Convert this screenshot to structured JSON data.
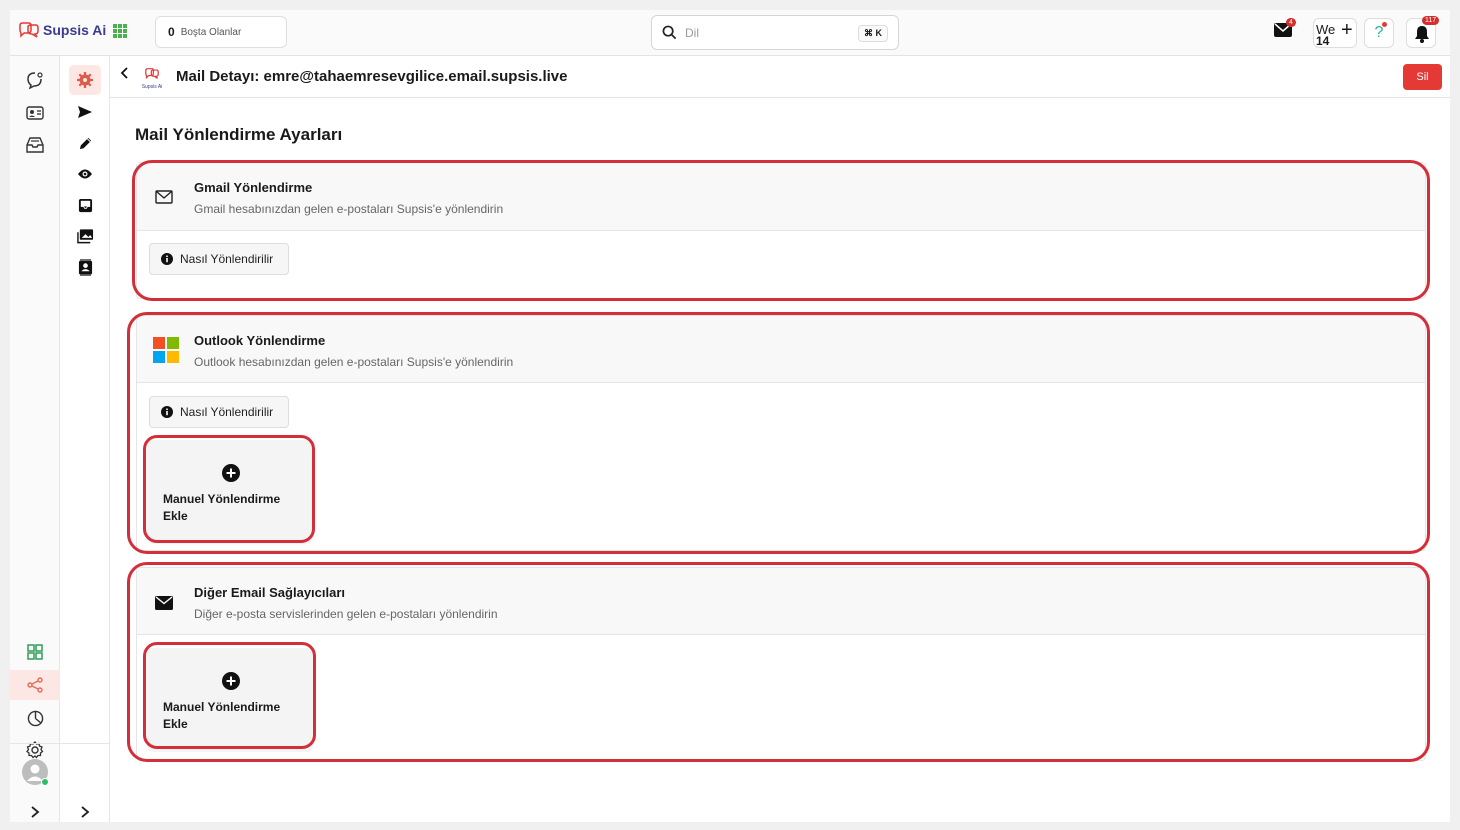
{
  "brand": {
    "name": "Supsis Ai",
    "mini_name": "Supsis Ai"
  },
  "topbar": {
    "idle_count": "0",
    "idle_label": "Boşta Olanlar",
    "search_placeholder": "Dil",
    "search_shortcut": "⌘ K",
    "mail_badge": "4",
    "we_label": "We",
    "we_number": "14",
    "notification_badge": "117"
  },
  "header": {
    "title": "Mail Detayı: emre@tahaemresevgilice.email.supsis.live",
    "delete_label": "Sil"
  },
  "page": {
    "section_title": "Mail Yönlendirme Ayarları"
  },
  "cards": [
    {
      "title": "Gmail Yönlendirme",
      "description": "Gmail hesabınızdan gelen e-postaları Supsis'e yönlendirin",
      "howto_label": "Nasıl Yönlendirilir"
    },
    {
      "title": "Outlook Yönlendirme",
      "description": "Outlook hesabınızdan gelen e-postaları Supsis'e yönlendirin",
      "howto_label": "Nasıl Yönlendirilir",
      "add_label": "Manuel Yönlendirme Ekle"
    },
    {
      "title": "Diğer Email Sağlayıcıları",
      "description": "Diğer e-posta servislerinden gelen e-postaları yönlendirin",
      "add_label": "Manuel Yönlendirme Ekle"
    }
  ],
  "colors": {
    "accent": "#e53935",
    "highlight": "#d32f3a",
    "brand": "#3b3b8f"
  },
  "icons": {
    "rail1": [
      "chat-icon",
      "contact-card-icon",
      "inbox-icon",
      "dashboard-icon",
      "share-icon",
      "chart-icon",
      "settings-icon",
      "avatar",
      "expand-icon"
    ],
    "rail2": [
      "gear-icon",
      "send-icon",
      "edit-icon",
      "eye-icon",
      "inbox-tray-icon",
      "gallery-icon",
      "contacts-icon",
      "expand-icon"
    ]
  }
}
